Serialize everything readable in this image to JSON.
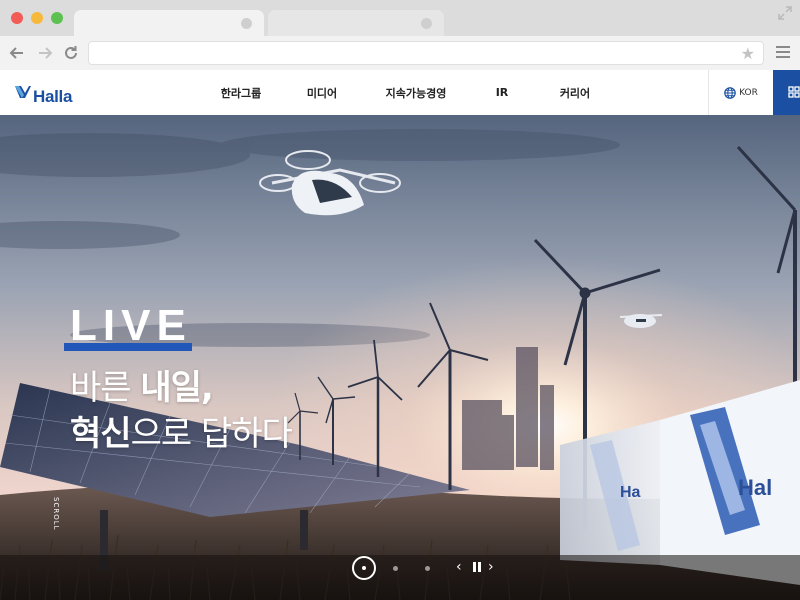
{
  "browser": {
    "address_value": "",
    "star_icon": "★"
  },
  "header": {
    "logo_text": "Halla",
    "nav": [
      "한라그룹",
      "미디어",
      "지속가능경영",
      "IR",
      "커리어"
    ],
    "lang_label": "KOR"
  },
  "hero": {
    "keyword": "LIVE",
    "headline_line1_light": "바른 ",
    "headline_line1_bold": "내일,",
    "headline_line2_bold": "혁신",
    "headline_line2_light": "으로 답하다",
    "scroll_label": "SCROLL",
    "container_logo_1": "Ha",
    "container_logo_2": "Hal",
    "prev_arrow": "‹",
    "next_arrow": "›"
  },
  "colors": {
    "brand_blue": "#1a4fa1",
    "accent_underline": "#2157b8"
  }
}
